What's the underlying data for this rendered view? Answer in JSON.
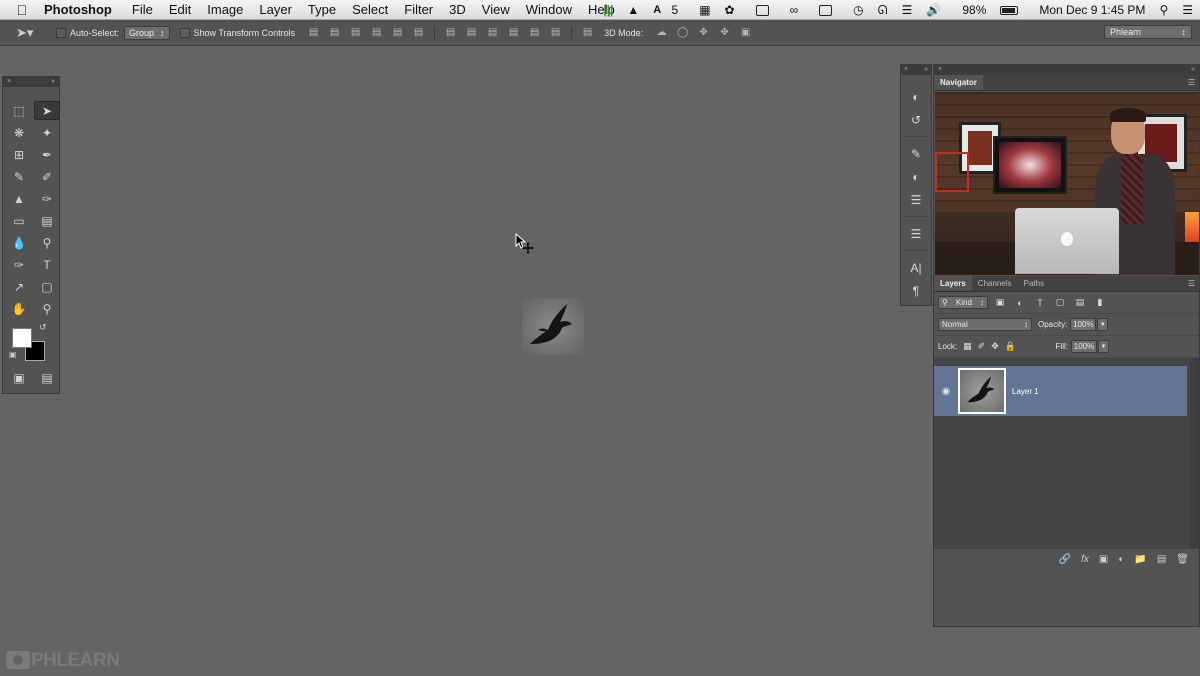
{
  "menubar": {
    "app_name": "Photoshop",
    "items": [
      "File",
      "Edit",
      "Image",
      "Layer",
      "Type",
      "Select",
      "Filter",
      "3D",
      "View",
      "Window",
      "Help"
    ],
    "adobe_badge": "5",
    "battery": "98%",
    "clock": "Mon Dec 9  1:45 PM"
  },
  "options_bar": {
    "auto_select_label": "Auto-Select:",
    "auto_select_value": "Group",
    "show_transform_label": "Show Transform Controls",
    "mode_3d_label": "3D Mode:",
    "workspace": "Phlearn"
  },
  "navigator": {
    "tab_label": "Navigator"
  },
  "layers_panel": {
    "tabs": [
      "Layers",
      "Channels",
      "Paths"
    ],
    "filter_kind": "Kind",
    "blend_mode": "Normal",
    "opacity_label": "Opacity:",
    "opacity_value": "100%",
    "lock_label": "Lock:",
    "fill_label": "Fill:",
    "fill_value": "100%",
    "layers": [
      {
        "name": "Layer 1",
        "visible": true,
        "selected": true
      }
    ]
  },
  "watermark": {
    "text": "PHLEARN"
  },
  "colors": {
    "workspace_bg": "#646464",
    "panel_bg": "#535353",
    "selected_layer": "#637495",
    "foreground_color": "#ffffff",
    "background_color": "#000000"
  }
}
